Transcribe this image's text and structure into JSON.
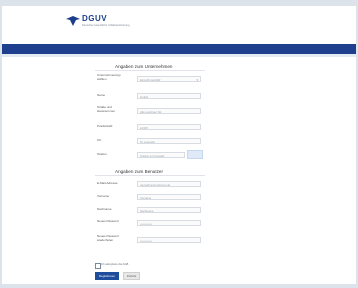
{
  "header": {
    "brand": "DGUV",
    "brand_subtitle": "Deutsche Gesetzliche Unfallversicherung"
  },
  "sections": {
    "company": {
      "title": "Angaben zum Unternehmen",
      "fields": [
        {
          "label": "Unternehmenstyp wählen",
          "value": "Einzelfirma/GbR"
        },
        {
          "label": "Name",
          "value": "GmbH"
        },
        {
          "label": "Straße und Hausnummer",
          "value": "Alte Leipziger Str."
        },
        {
          "label": "Postleitzahl",
          "value": "12345"
        },
        {
          "label": "Ort",
          "value": "St. Augustin"
        },
        {
          "label": "Telefon",
          "value": "Telefon mit Vorwahl"
        }
      ]
    },
    "person": {
      "title": "Angaben zum Benutzer",
      "fields": [
        {
          "label": "E-Mail-Adresse",
          "value": "name@unternehmen.de"
        },
        {
          "label": "Vorname",
          "value": "Vorname"
        },
        {
          "label": "Nachname",
          "value": "Nachname"
        },
        {
          "label": "Neues Passwort",
          "value": "••••••••••••"
        },
        {
          "label": "Neues Passwort wiederholen",
          "value": "••••••••••••"
        }
      ]
    }
  },
  "consent": {
    "label": "Ich akzeptiere die AGB"
  },
  "buttons": {
    "register": "Registrieren",
    "cancel": "Zurück"
  },
  "colors": {
    "brand_blue": "#1d3f8e",
    "button_blue": "#1e4d9c"
  }
}
